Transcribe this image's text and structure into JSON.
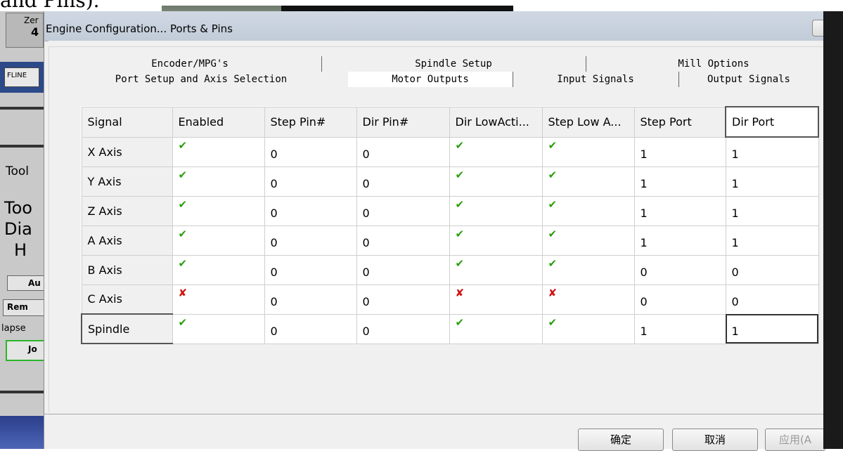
{
  "page_heading_fragment": "and Pins).",
  "background": {
    "left_labels": [
      "Zer",
      "4",
      "FLINE",
      "Tool",
      "Too",
      "Dia",
      "H",
      "Au",
      "Rem",
      "lapse",
      "Jo"
    ]
  },
  "dialog": {
    "title": "Engine Configuration... Ports & Pins",
    "tabs_row1": [
      "Encoder/MPG's",
      "Spindle Setup",
      "Mill Options"
    ],
    "tabs_row2": [
      "Port Setup and Axis Selection",
      "Motor Outputs",
      "Input Signals",
      "Output Signals"
    ],
    "active_tab": "Motor Outputs",
    "table": {
      "columns": [
        "Signal",
        "Enabled",
        "Step Pin#",
        "Dir Pin#",
        "Dir LowActi...",
        "Step Low A...",
        "Step Port",
        "Dir Port"
      ],
      "rows": [
        {
          "signal": "X Axis",
          "enabled": true,
          "step_pin": "0",
          "dir_pin": "0",
          "dir_low": true,
          "step_low": true,
          "step_port": "1",
          "dir_port": "1"
        },
        {
          "signal": "Y Axis",
          "enabled": true,
          "step_pin": "0",
          "dir_pin": "0",
          "dir_low": true,
          "step_low": true,
          "step_port": "1",
          "dir_port": "1"
        },
        {
          "signal": "Z Axis",
          "enabled": true,
          "step_pin": "0",
          "dir_pin": "0",
          "dir_low": true,
          "step_low": true,
          "step_port": "1",
          "dir_port": "1"
        },
        {
          "signal": "A Axis",
          "enabled": true,
          "step_pin": "0",
          "dir_pin": "0",
          "dir_low": true,
          "step_low": true,
          "step_port": "1",
          "dir_port": "1"
        },
        {
          "signal": "B Axis",
          "enabled": true,
          "step_pin": "0",
          "dir_pin": "0",
          "dir_low": true,
          "step_low": true,
          "step_port": "0",
          "dir_port": "0"
        },
        {
          "signal": "C Axis",
          "enabled": false,
          "step_pin": "0",
          "dir_pin": "0",
          "dir_low": false,
          "step_low": false,
          "step_port": "0",
          "dir_port": "0"
        },
        {
          "signal": "Spindle",
          "enabled": true,
          "step_pin": "0",
          "dir_pin": "0",
          "dir_low": true,
          "step_low": true,
          "step_port": "1",
          "dir_port": "1"
        }
      ]
    },
    "buttons": {
      "ok": "确定",
      "cancel": "取消",
      "apply": "应用(A"
    }
  },
  "icons": {
    "yes": "check-icon",
    "no": "cross-icon"
  },
  "colors": {
    "check": "#2a9d0b",
    "cross": "#d01010",
    "title_bar": "#c8d1dd"
  }
}
